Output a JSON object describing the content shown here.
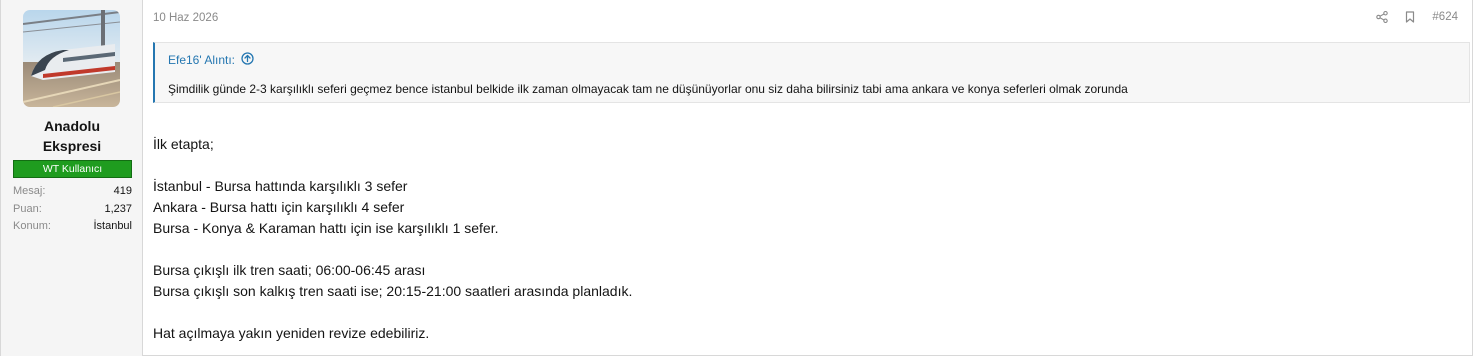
{
  "user": {
    "name": "Anadolu Ekspresi",
    "title_badge": "WT Kullanıcı",
    "stats": [
      {
        "label": "Mesaj:",
        "value": "419"
      },
      {
        "label": "Puan:",
        "value": "1,237"
      },
      {
        "label": "Konum:",
        "value": "İstanbul"
      }
    ]
  },
  "post": {
    "date": "10 Haz 2026",
    "number": "#624",
    "quote": {
      "author_line": "Efe16' Alıntı:",
      "text": "Şimdilik günde 2-3 karşılıklı seferi geçmez bence istanbul belkide ilk zaman olmayacak tam ne düşünüyorlar onu siz daha bilirsiniz tabi ama ankara ve konya seferleri olmak zorunda"
    },
    "body": {
      "line1": "İlk etapta;",
      "line2": "İstanbul - Bursa hattında karşılıklı 3 sefer",
      "line3": "Ankara - Bursa hattı için karşılıklı 4 sefer",
      "line4": "Bursa - Konya & Karaman hattı için ise karşılıklı 1 sefer.",
      "line5": "Bursa çıkışlı ilk tren saati; 06:00-06:45 arası",
      "line6": "Bursa çıkışlı son kalkış tren saati ise; 20:15-21:00 saatleri arasında planladık.",
      "line7": "Hat açılmaya yakın yeniden revize edebiliriz."
    }
  },
  "icons": {
    "share": "share-icon",
    "bookmark": "bookmark-icon",
    "quote_jump": "arrow-up-circle-icon"
  },
  "colors": {
    "link": "#2577b1",
    "badge": "#1f9c1f",
    "muted": "#8a8a8a"
  }
}
